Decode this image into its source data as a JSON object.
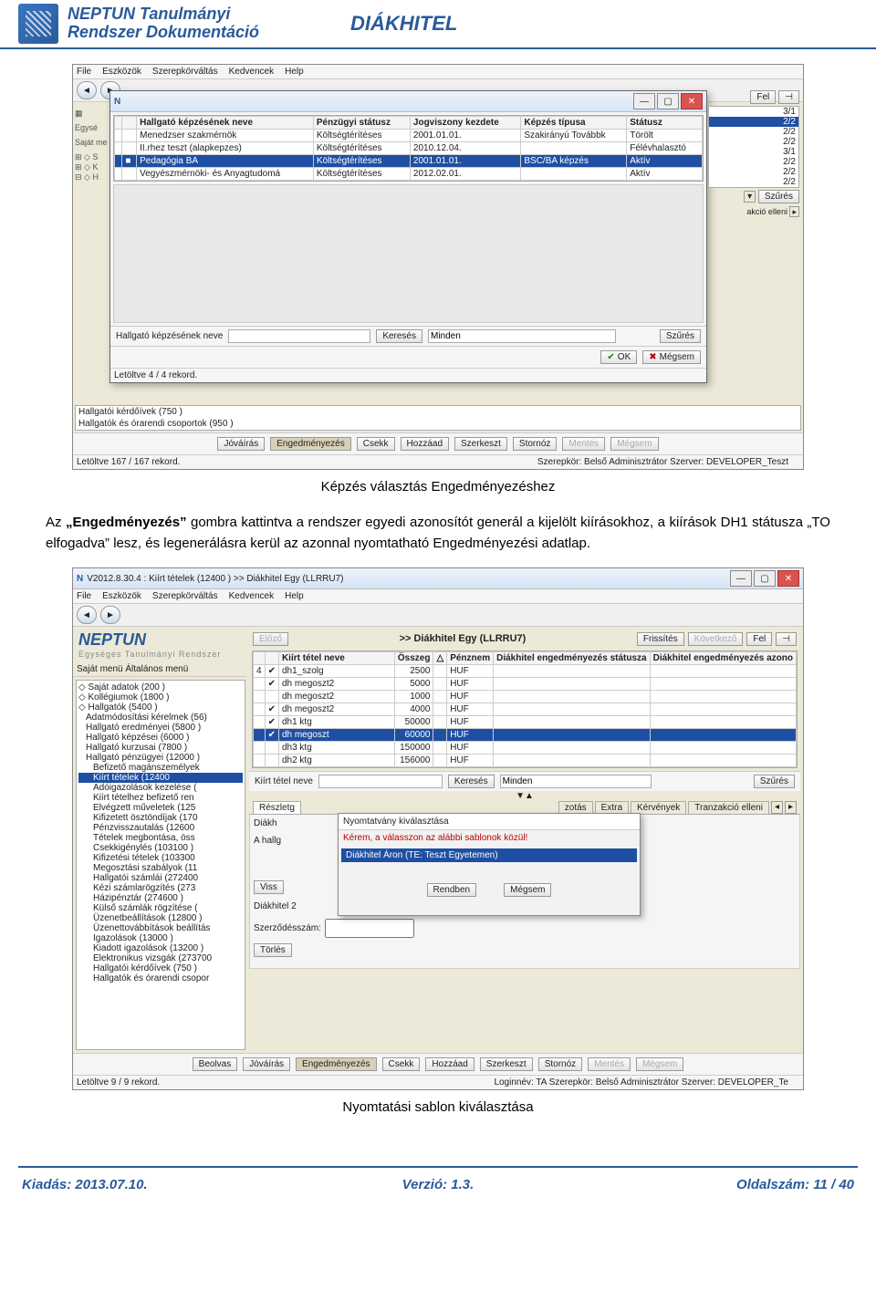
{
  "header": {
    "title_line1": "NEPTUN Tanulmányi",
    "title_line2": "Rendszer Dokumentáció",
    "right": "DIÁKHITEL"
  },
  "ss1": {
    "menus": [
      "File",
      "Eszközök",
      "Szerepkörváltás",
      "Kedvencek",
      "Help"
    ],
    "side_labels": [
      "Egysé",
      "Saját me",
      "S",
      "K",
      "H"
    ],
    "side_ratios": [
      "3/1",
      "2/2",
      "2/2",
      "2/2",
      "3/1",
      "2/2",
      "2/2",
      "2/2"
    ],
    "side_right_btns": [
      "Fel"
    ],
    "szures_btn": "Szűrés",
    "akcio_elleni": "akció elleni",
    "cols": [
      "",
      "",
      "Hallgató képzésének neve",
      "Pénzügyi státusz",
      "Jogviszony kezdete",
      "Képzés típusa",
      "Státusz"
    ],
    "rows": [
      {
        "c": [
          "",
          "",
          "Menedzser szakmérnök",
          "Költségtérítéses",
          "2001.01.01.",
          "Szakirányú Továbbk",
          "Törölt"
        ],
        "sel": false
      },
      {
        "c": [
          "",
          "",
          "II.rhez teszt (alapkepzes)",
          "Költségtérítéses",
          "2010.12.04.",
          "",
          "Félévhalasztó"
        ],
        "sel": false
      },
      {
        "c": [
          "",
          "■",
          "Pedagógia BA",
          "Költségtérítéses",
          "2001.01.01.",
          "BSC/BA képzés",
          "Aktív"
        ],
        "sel": true
      },
      {
        "c": [
          "",
          "",
          "Vegyészmérnöki- és Anyagtudomá",
          "Költségtérítéses",
          "2012.02.01.",
          "",
          "Aktív"
        ],
        "sel": false
      }
    ],
    "search": {
      "label": "Hallgató képzésének neve",
      "btn": "Keresés",
      "minden": "Minden",
      "szures": "Szűrés"
    },
    "ok": "OK",
    "megsem": "Mégsem",
    "loaded": "Letöltve 4 / 4 rekord.",
    "listrows": [
      "Hallgatói kérdőívek (750 )",
      "Hallgatók és órarendi csoportok (950 )"
    ],
    "raw_buttons": [
      "Jóváírás",
      "Engedményezés",
      "Csekk",
      "Hozzáad",
      "Szerkeszt",
      "Stornóz",
      "Mentés",
      "Mégsem"
    ],
    "status": {
      "loaded": "Letöltve 167 / 167 rekord.",
      "role": "Szerepkör: Belső Adminisztrátor  Szerver: DEVELOPER_Teszt"
    }
  },
  "caption1": "Képzés választás Engedményezéshez",
  "para": {
    "p1_a": "Az ",
    "p1_bold": "„Engedményezés”",
    "p1_b": " gombra kattintva a rendszer egyedi azonosítót generál a kijelölt kiírásokhoz, a kiírások DH1 státusza „TO elfogadva” lesz, és legenerálásra kerül az azonnal nyomtatható Engedményezési adatlap."
  },
  "ss2": {
    "title": "V2012.8.30.4 : Kiírt tételek (12400  ) >> Diákhitel Egy (LLRRU7)",
    "menus": [
      "File",
      "Eszközök",
      "Szerepkörváltás",
      "Kedvencek",
      "Help"
    ],
    "breadcrumb": ">> Diákhitel Egy (LLRRU7)",
    "breadcrumb_btns": {
      "prev": "Előző",
      "refresh": "Frissítés",
      "next": "Következő",
      "up": "Fel"
    },
    "neptun": "NEPTUN",
    "neptun_sub": "Egységes Tanulmányi Rendszer",
    "treetabs": "Saját menü  Általános menü",
    "tree": [
      "Saját adatok (200 )",
      "Kollégiumok (1800 )",
      "Hallgatók (5400 )",
      "  Adatmódosítási kérelmek (56)",
      "  Hallgató eredményei (5800 )",
      "  Hallgató képzései (6000 )",
      "  Hallgató kurzusai (7800 )",
      "  Hallgató pénzügyei (12000 )",
      "    Befizető magánszemélyek",
      "    Kiírt tételek (12400",
      "    Adóigazolások kezelése (",
      "    Kiírt tételhez befizető ren",
      "    Elvégzett műveletek (125",
      "    Kifizetett ösztöndíjak (170",
      "    Pénzvisszautalás (12600",
      "    Tételek megbontása, öss",
      "    Csekkigénylés (103100 )",
      "    Kifizetési tételek (103300",
      "    Megosztási szabályok (11",
      "    Hallgatói számlái (272400",
      "    Kézi számlarögzítés (273",
      "    Házipénztár (274600 )",
      "    Külső számlák rögzítése (",
      "    Üzenetbeállítások (12800 )",
      "    Üzenettovábbítások beállítás",
      "    Igazolások (13000 )",
      "    Kiadott igazolások (13200 )",
      "    Elektronikus vizsgák (273700",
      "    Hallgatói kérdőívek (750 )",
      "    Hallgatók és órarendi csopor"
    ],
    "tree_hl_index": 9,
    "gridcols": [
      "",
      "",
      "Kiírt tétel neve",
      "Összeg",
      "△",
      "Pénznem",
      "Diákhitel engedményezés státusza",
      "Diákhitel engedményezés azono"
    ],
    "gridrows": [
      {
        "c": [
          "4",
          "✔",
          "dh1_szolg",
          "2500",
          "",
          "HUF",
          "",
          ""
        ],
        "sel": false
      },
      {
        "c": [
          "",
          "✔",
          "dh megoszt2",
          "5000",
          "",
          "HUF",
          "",
          ""
        ],
        "sel": false
      },
      {
        "c": [
          "",
          "",
          "dh megoszt2",
          "1000",
          "",
          "HUF",
          "",
          ""
        ],
        "sel": false
      },
      {
        "c": [
          "",
          "✔",
          "dh megoszt2",
          "4000",
          "",
          "HUF",
          "",
          ""
        ],
        "sel": false
      },
      {
        "c": [
          "",
          "✔",
          "dh1 ktg",
          "50000",
          "",
          "HUF",
          "",
          ""
        ],
        "sel": false
      },
      {
        "c": [
          "",
          "✔",
          "dh megoszt",
          "60000",
          "",
          "HUF",
          "",
          ""
        ],
        "sel": true
      },
      {
        "c": [
          "",
          "",
          "dh3 ktg",
          "150000",
          "",
          "HUF",
          "",
          ""
        ],
        "sel": false
      },
      {
        "c": [
          "",
          "",
          "dh2 ktg",
          "156000",
          "",
          "HUF",
          "",
          ""
        ],
        "sel": false
      }
    ],
    "search": {
      "label": "Kiírt tétel neve",
      "btn": "Keresés",
      "minden": "Minden",
      "szures": "Szűrés"
    },
    "tabs": [
      "Részletg",
      "            ",
      "zotás",
      "Extra",
      "Kérvények",
      "Tranzakció elleni"
    ],
    "diakhlabel": "Diákh",
    "ahallg": "A hallg",
    "dialog": {
      "title": "Nyomtatvány kiválasztása",
      "red": "Kérem, a válasszon az alábbi sablonok közül!",
      "item": "Diákhitel Áron   (TE: Teszt Egyetemen)",
      "ok": "Rendben",
      "cancel": "Mégsem"
    },
    "lower_labels": [
      "Viss",
      "Diákhitel 2",
      "Szerződésszám:",
      "Törlés"
    ],
    "bottom_buttons": [
      "Beolvas",
      "Jóváírás",
      "Engedményezés",
      "Csekk",
      "Hozzáad",
      "Szerkeszt",
      "Stornóz",
      "Mentés",
      "Mégsem"
    ],
    "status": {
      "loaded": "Letöltve 9 / 9 rekord.",
      "role": "Loginnév: TA  Szerepkör: Belső Adminisztrátor  Szerver: DEVELOPER_Te"
    }
  },
  "caption2": "Nyomtatási sablon kiválasztása",
  "footer": {
    "left": "Kiadás: 2013.07.10.",
    "mid": "Verzió: 1.3.",
    "right": "Oldalszám: 11 / 40"
  }
}
